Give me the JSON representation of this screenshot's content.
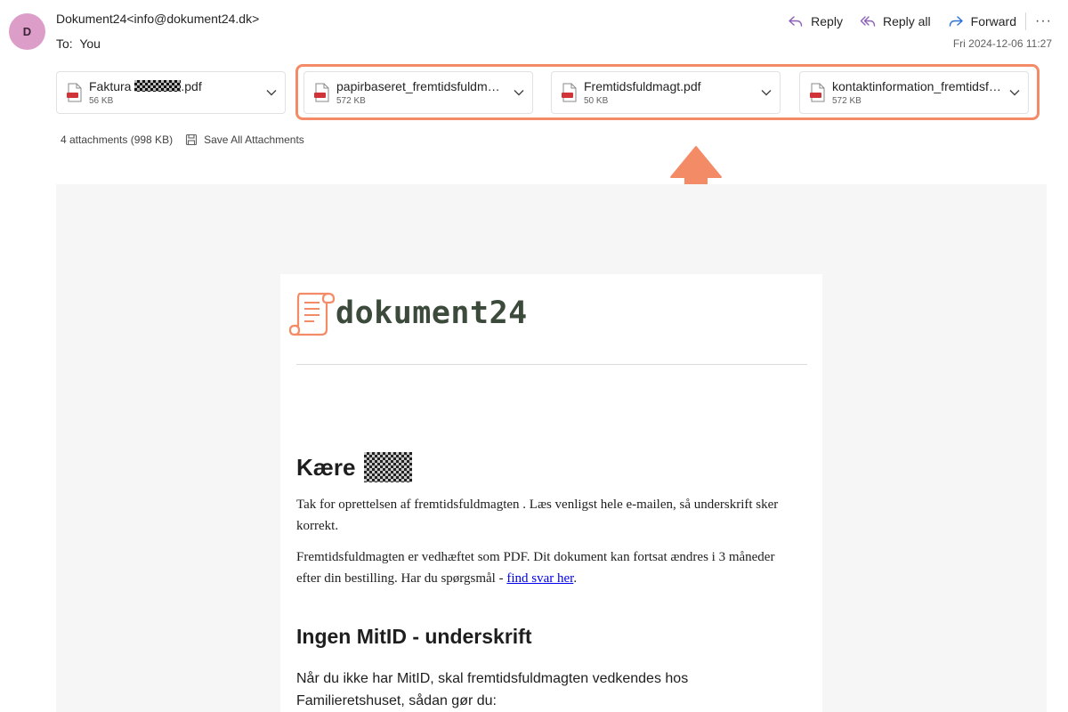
{
  "header": {
    "avatar_initial": "D",
    "sender": "Dokument24<info@dokument24.dk>",
    "to_label": "To:",
    "to_value": "You",
    "datetime": "Fri 2024-12-06 11:27",
    "actions": {
      "reply": "Reply",
      "reply_all": "Reply all",
      "forward": "Forward",
      "more": "···"
    }
  },
  "attachments": {
    "items": [
      {
        "name_prefix": "Faktura ",
        "name_suffix": ".pdf",
        "size": "56 KB"
      },
      {
        "name": "papirbaseret_fremtidsfuldmagt.pdf",
        "size": "572 KB"
      },
      {
        "name": "Fremtidsfuldmagt.pdf",
        "size": "50 KB"
      },
      {
        "name": "kontaktinformation_fremtidsfuldmagt.pdf",
        "size": "572 KB"
      }
    ],
    "summary": "4 attachments (998 KB)",
    "save_all": "Save All Attachments"
  },
  "colors": {
    "accent_orange": "#f48b67",
    "avatar_bg": "#dd9dc9",
    "logo_text": "#3c4a3c",
    "action_icon": "#8a5fb8"
  },
  "email": {
    "logo_text": "dokument24",
    "greeting": "Kære",
    "para1": "Tak for oprettelsen af fremtidsfuldmagten . Læs venligst hele e-mailen, så underskrift sker korrekt.",
    "para2_text": "Fremtidsfuldmagten er vedhæftet som PDF. Dit dokument kan fortsat ændres i 3 måneder efter din bestilling. Har du spørgsmål - ",
    "para2_link": "find svar her",
    "para2_end": ".",
    "heading2": "Ingen MitID - underskrift",
    "para3": "Når du ikke har MitID, skal fremtidsfuldmagten vedkendes hos Familieretshuset, sådan gør du:"
  }
}
